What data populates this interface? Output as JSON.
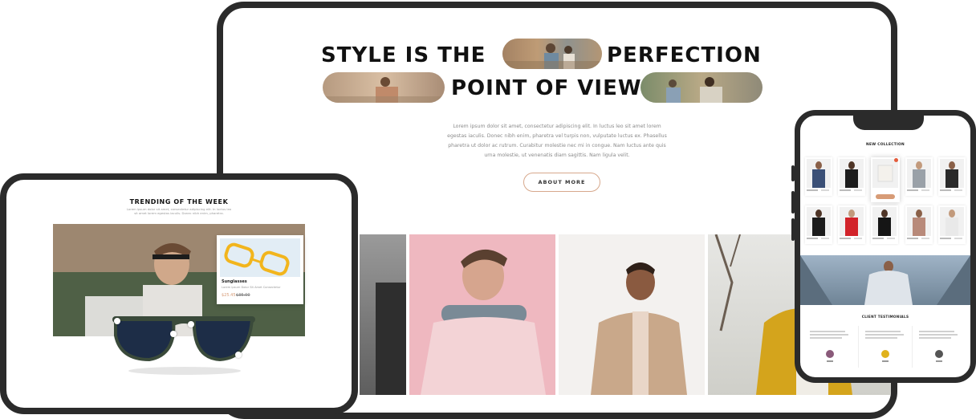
{
  "desktop": {
    "hero_line_1a": "STYLE IS THE",
    "hero_line_1b": "PERFECTION",
    "hero_line_2": "POINT OF VIEW",
    "paragraph_lines": [
      "Lorem ipsum dolor sit amet, consectetur adipiscing elit. In luctus leo sit amet lorem",
      "egestas iaculis. Donec nibh enim, pharetra vel turpis non, vulputate luctus ex. Phasellus",
      "pharetra ut dolor ac rutrum. Curabitur molestie nec mi in congue. Nam luctus ante quis",
      "urna molestie, ut venenatis diam sagittis. Nam ligula velit."
    ],
    "button_label": "ABOUT MORE"
  },
  "tablet": {
    "section_title": "TRENDING OF THE WEEK",
    "section_sub": [
      "Lorem ipsum dolor sit amet, consectetur adipiscing elit. In luctus leo",
      "sit amet lorem egestas iaculis. Donec nibh enim, pharetra."
    ],
    "product": {
      "name": "Sunglasses",
      "description": "Lorem ipsum Dolor Sit Amet Consectetur",
      "price": "$25.45",
      "old_price": "$35.00"
    }
  },
  "phone": {
    "collection_title": "NEW COLLECTION",
    "testimonials_title": "CLIENT TESTIMONIALS"
  },
  "colors": {
    "frame": "#2b2b2b",
    "accent": "#d79b76",
    "button_border": "#d7a88c"
  }
}
